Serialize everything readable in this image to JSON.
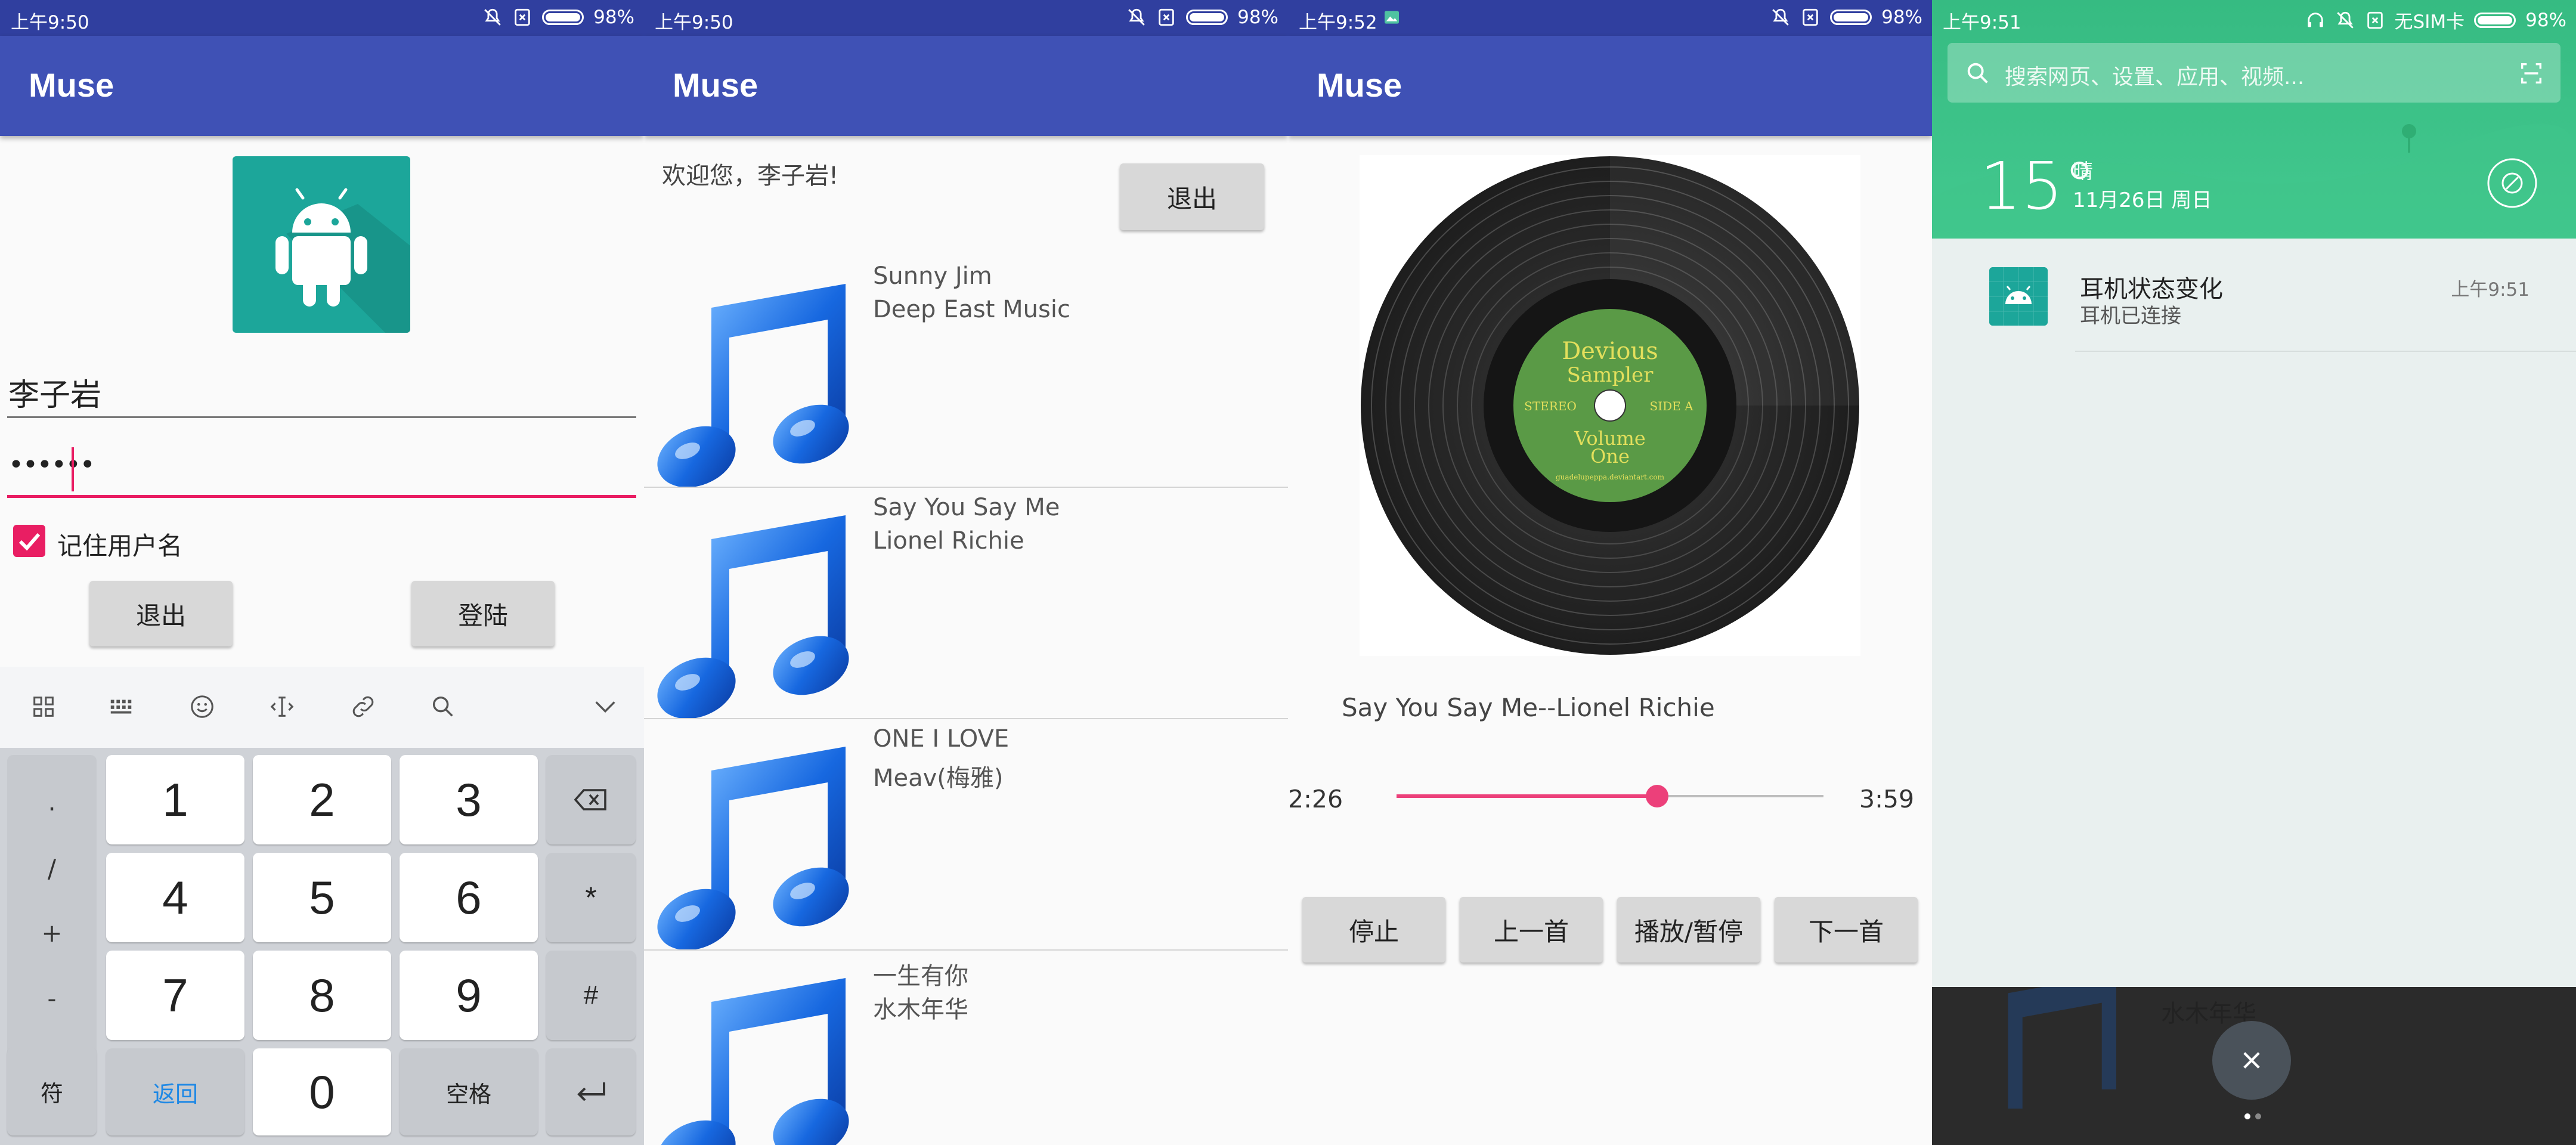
{
  "screen1": {
    "status_time": "上午9:50",
    "battery": "98%",
    "app_title": "Muse",
    "username": "李子岩",
    "password": "••••••",
    "remember_label": "记住用户名",
    "remember_checked": true,
    "exit_button": "退出",
    "login_button": "登陆",
    "keyboard": {
      "symbols": [
        ".",
        "/",
        "+",
        "-",
        "符"
      ],
      "keys": [
        "1",
        "2",
        "3",
        "4",
        "5",
        "6",
        "7",
        "8",
        "9",
        "0"
      ],
      "star": "*",
      "hash": "#",
      "back_label": "返回",
      "space_label": "空格"
    }
  },
  "screen2": {
    "status_time": "上午9:50",
    "battery": "98%",
    "app_title": "Muse",
    "welcome": "欢迎您，李子岩!",
    "exit_button": "退出",
    "songs": [
      {
        "title": "Sunny Jim",
        "artist": "Deep East Music"
      },
      {
        "title": "Say You Say Me",
        "artist": "Lionel Richie"
      },
      {
        "title": "ONE I LOVE",
        "artist": "Meav(梅雅)"
      },
      {
        "title": "一生有你",
        "artist": "水木年华"
      }
    ]
  },
  "screen3": {
    "status_time": "上午9:52",
    "battery": "98%",
    "app_title": "Muse",
    "record_label": {
      "line1": "Devious",
      "line2": "Sampler",
      "left": "STEREO",
      "right": "SIDE A",
      "line3": "Volume",
      "line4": "One",
      "credit": "guadelupeppa.deviantart.com"
    },
    "now_playing": "Say You Say Me--Lionel Richie",
    "elapsed": "2:26",
    "duration": "3:59",
    "progress": 0.61,
    "buttons": [
      "停止",
      "上一首",
      "播放/暂停",
      "下一首"
    ]
  },
  "screen4": {
    "status_time": "上午9:51",
    "carrier": "无SIM卡",
    "battery": "98%",
    "search_placeholder": "搜索网页、设置、应用、视频...",
    "temperature": "15°",
    "condition": "晴",
    "date": "11月26日 周日",
    "notification": {
      "title": "耳机状态变化",
      "body": "耳机已连接",
      "time": "上午9:51"
    },
    "background_text": "水木年华"
  },
  "colors": {
    "primary": "#3f51b5",
    "primary_dark": "#303f9f",
    "accent": "#e91e63",
    "notification_green": "#36bb82"
  }
}
